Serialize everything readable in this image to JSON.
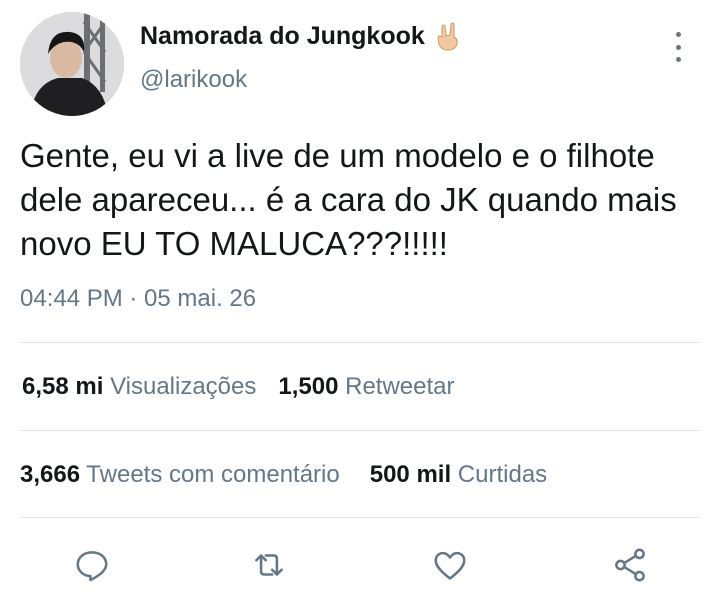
{
  "author": {
    "display_name": "Namorada do Jungkook",
    "handle": "@larikook",
    "emoji_icon": "sign-of-the-horns-hand-icon"
  },
  "tweet": {
    "text": "Gente, eu vi a live de um modelo e o filhote dele apareceu... é a cara do JK quando mais novo EU TO MALUCA???!!!!!",
    "timestamp": "04:44 PM · 05 mai. 26"
  },
  "stats": {
    "views_count": "6,58 mi",
    "views_label": "Visualizações",
    "retweets_count": "1,500",
    "retweets_label": "Retweetar",
    "quotes_count": "3,666",
    "quotes_label": "Tweets com comentário",
    "likes_count": "500 mil",
    "likes_label": "Curtidas"
  },
  "actions": [
    "reply-icon",
    "retweet-icon",
    "like-icon",
    "share-icon"
  ],
  "colors": {
    "text": "#14171a",
    "secondary": "#657786",
    "divider": "#e1e8ed"
  }
}
